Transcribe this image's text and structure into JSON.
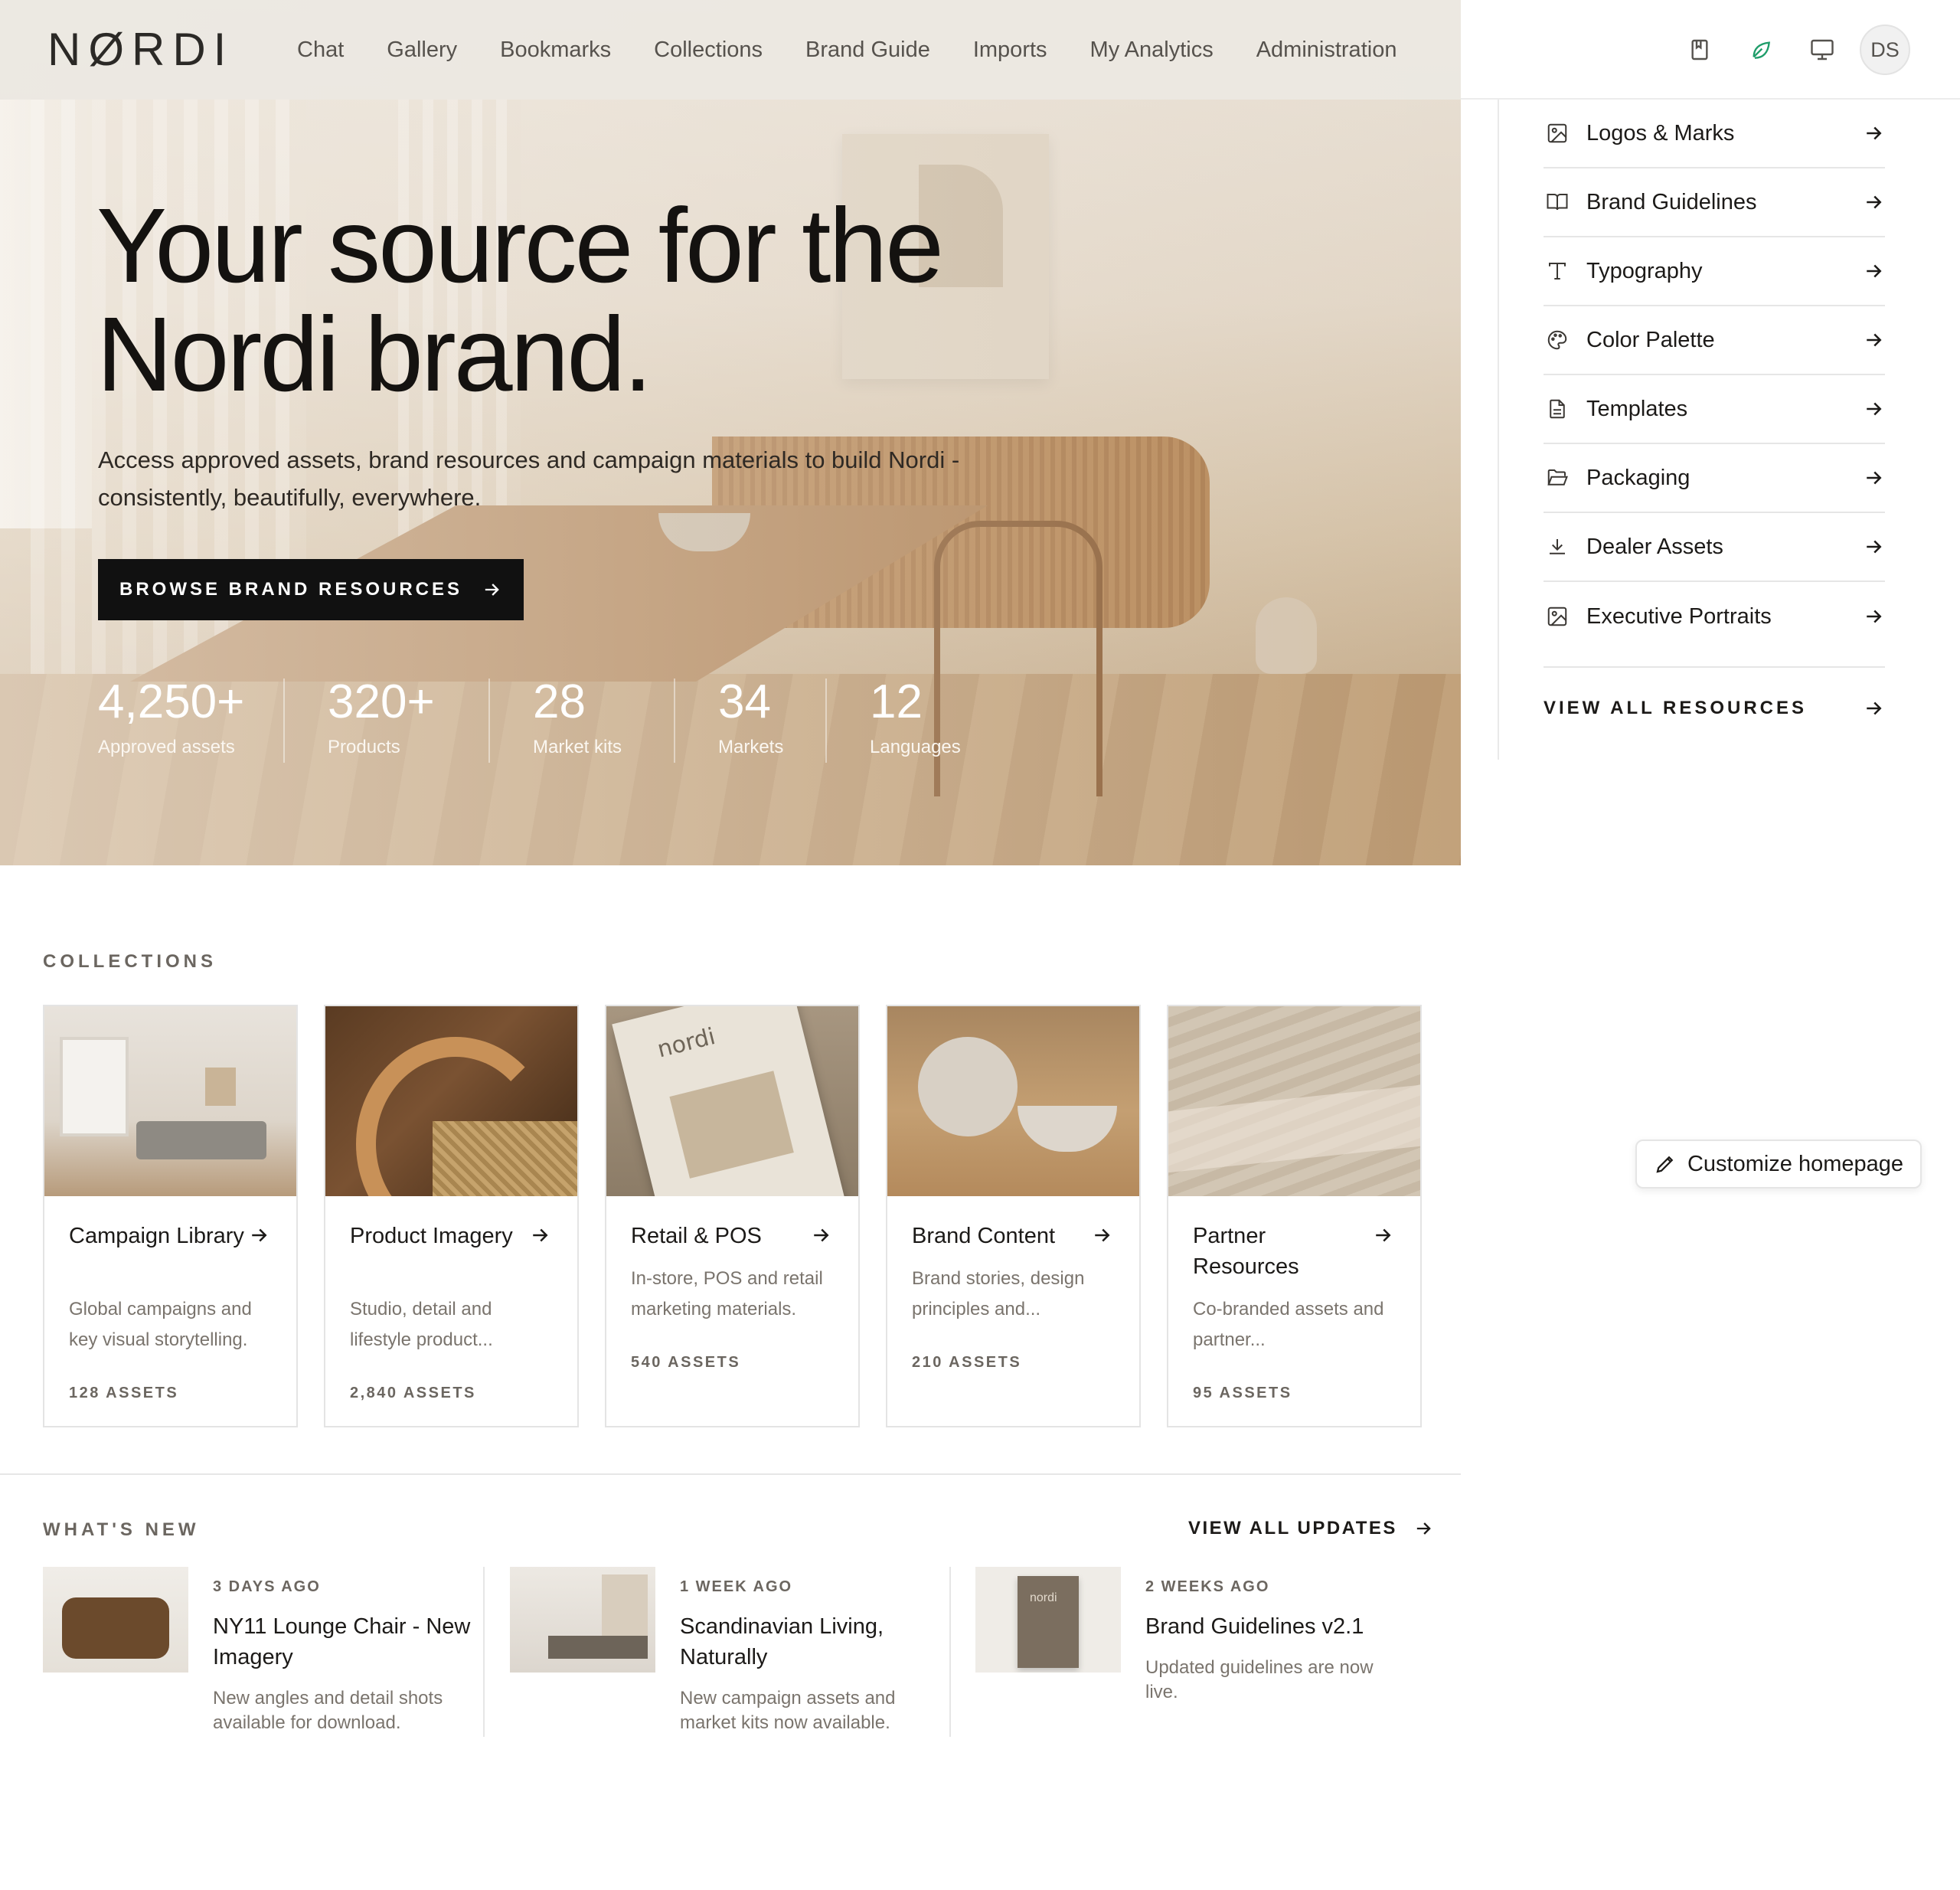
{
  "brand": {
    "logo": "NØRDI"
  },
  "nav": {
    "links": [
      "Chat",
      "Gallery",
      "Bookmarks",
      "Collections",
      "Brand Guide",
      "Imports",
      "My Analytics",
      "Administration"
    ],
    "icons": [
      "bookmark-icon",
      "leaf-icon",
      "monitor-icon"
    ],
    "avatar_initials": "DS",
    "accent_color": "#1f9d6a"
  },
  "hero": {
    "title": "Your source for the Nordi brand.",
    "subtitle": "Access approved assets, brand resources and campaign materials to build Nordi - consistently, beautifully, everywhere.",
    "cta_label": "BROWSE BRAND RESOURCES",
    "stats": [
      {
        "value": "4,250+",
        "label": "Approved assets"
      },
      {
        "value": "320+",
        "label": "Products"
      },
      {
        "value": "28",
        "label": "Market kits"
      },
      {
        "value": "34",
        "label": "Markets"
      },
      {
        "value": "12",
        "label": "Languages"
      }
    ]
  },
  "resources": {
    "items": [
      {
        "label": "Logos & Marks",
        "icon": "image-icon"
      },
      {
        "label": "Brand Guidelines",
        "icon": "book-open-icon"
      },
      {
        "label": "Typography",
        "icon": "type-icon"
      },
      {
        "label": "Color Palette",
        "icon": "palette-icon"
      },
      {
        "label": "Templates",
        "icon": "file-text-icon"
      },
      {
        "label": "Packaging",
        "icon": "folder-open-icon"
      },
      {
        "label": "Dealer Assets",
        "icon": "download-icon"
      },
      {
        "label": "Executive Portraits",
        "icon": "image-icon"
      }
    ],
    "view_all_label": "VIEW ALL RESOURCES"
  },
  "collections": {
    "section_title": "COLLECTIONS",
    "cards": [
      {
        "title": "Campaign Library",
        "desc": "Global campaigns and key visual storytelling.",
        "count": "128 ASSETS"
      },
      {
        "title": "Product Imagery",
        "desc": "Studio, detail and lifestyle product...",
        "count": "2,840 ASSETS"
      },
      {
        "title": "Retail & POS",
        "desc": "In-store, POS and retail marketing materials.",
        "count": "540 ASSETS"
      },
      {
        "title": "Brand Content",
        "desc": "Brand stories, design principles and...",
        "count": "210 ASSETS"
      },
      {
        "title": "Partner Resources",
        "desc": "Co-branded assets and partner...",
        "count": "95 ASSETS"
      }
    ]
  },
  "whats_new": {
    "section_title": "WHAT'S NEW",
    "view_all_label": "VIEW ALL UPDATES",
    "items": [
      {
        "date": "3 DAYS AGO",
        "title": "NY11 Lounge Chair - New Imagery",
        "desc": "New angles and detail shots available for download."
      },
      {
        "date": "1 WEEK AGO",
        "title": "Scandinavian Living, Naturally",
        "desc": "New campaign assets and market kits now available."
      },
      {
        "date": "2 WEEKS AGO",
        "title": "Brand Guidelines v2.1",
        "desc": "Updated guidelines are now live."
      }
    ]
  },
  "customize": {
    "label": "Customize homepage"
  }
}
